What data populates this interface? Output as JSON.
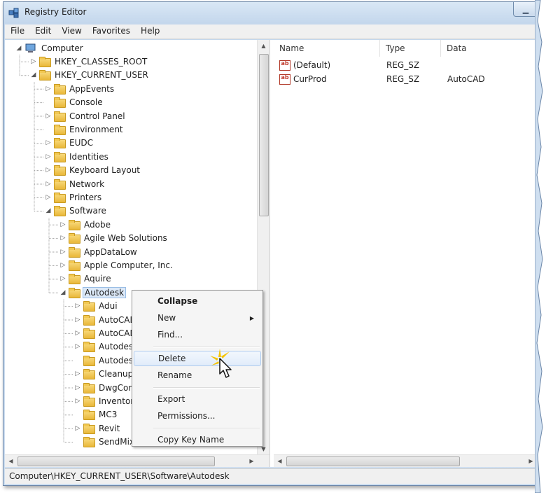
{
  "window": {
    "title": "Registry Editor"
  },
  "menu": [
    "File",
    "Edit",
    "View",
    "Favorites",
    "Help"
  ],
  "tree": [
    {
      "label": "Computer",
      "indent": 0,
      "toggle": "open",
      "icon": "computer-icon"
    },
    {
      "label": "HKEY_CLASSES_ROOT",
      "indent": 1,
      "toggle": "closed"
    },
    {
      "label": "HKEY_CURRENT_USER",
      "indent": 1,
      "toggle": "open"
    },
    {
      "label": "AppEvents",
      "indent": 2,
      "toggle": "closed"
    },
    {
      "label": "Console",
      "indent": 2,
      "toggle": "none"
    },
    {
      "label": "Control Panel",
      "indent": 2,
      "toggle": "closed"
    },
    {
      "label": "Environment",
      "indent": 2,
      "toggle": "none"
    },
    {
      "label": "EUDC",
      "indent": 2,
      "toggle": "closed"
    },
    {
      "label": "Identities",
      "indent": 2,
      "toggle": "closed"
    },
    {
      "label": "Keyboard Layout",
      "indent": 2,
      "toggle": "closed"
    },
    {
      "label": "Network",
      "indent": 2,
      "toggle": "closed"
    },
    {
      "label": "Printers",
      "indent": 2,
      "toggle": "closed"
    },
    {
      "label": "Software",
      "indent": 2,
      "toggle": "open"
    },
    {
      "label": "Adobe",
      "indent": 3,
      "toggle": "closed"
    },
    {
      "label": "Agile Web Solutions",
      "indent": 3,
      "toggle": "closed"
    },
    {
      "label": "AppDataLow",
      "indent": 3,
      "toggle": "closed"
    },
    {
      "label": "Apple Computer, Inc.",
      "indent": 3,
      "toggle": "closed"
    },
    {
      "label": "Aquire",
      "indent": 3,
      "toggle": "closed"
    },
    {
      "label": "Autodesk",
      "indent": 3,
      "toggle": "open",
      "selected": true
    },
    {
      "label": "Adui",
      "indent": 4,
      "toggle": "closed"
    },
    {
      "label": "AutoCAD",
      "indent": 4,
      "toggle": "closed"
    },
    {
      "label": "AutoCAD",
      "indent": 4,
      "toggle": "closed"
    },
    {
      "label": "Autodesk",
      "indent": 4,
      "toggle": "closed"
    },
    {
      "label": "Autodesk",
      "indent": 4,
      "toggle": "none"
    },
    {
      "label": "Cleanup",
      "indent": 4,
      "toggle": "closed"
    },
    {
      "label": "DwgCon",
      "indent": 4,
      "toggle": "closed"
    },
    {
      "label": "Inventor",
      "indent": 4,
      "toggle": "closed"
    },
    {
      "label": "MC3",
      "indent": 4,
      "toggle": "none"
    },
    {
      "label": "Revit",
      "indent": 4,
      "toggle": "closed"
    },
    {
      "label": "SendMix",
      "indent": 4,
      "toggle": "none"
    }
  ],
  "columns": {
    "name": "Name",
    "type": "Type",
    "data": "Data"
  },
  "values": [
    {
      "name": "(Default)",
      "type": "REG_SZ",
      "data": "",
      "icon": "string-value-icon"
    },
    {
      "name": "CurProd",
      "type": "REG_SZ",
      "data": "AutoCAD",
      "icon": "string-value-icon"
    }
  ],
  "context_menu": [
    {
      "label": "Collapse",
      "bold": true
    },
    {
      "label": "New",
      "submenu": true
    },
    {
      "label": "Find..."
    },
    {
      "separator": true
    },
    {
      "label": "Delete",
      "hover": true
    },
    {
      "label": "Rename"
    },
    {
      "separator": true
    },
    {
      "label": "Export"
    },
    {
      "label": "Permissions..."
    },
    {
      "separator": true
    },
    {
      "label": "Copy Key Name"
    }
  ],
  "status": "Computer\\HKEY_CURRENT_USER\\Software\\Autodesk",
  "colors": {
    "selection": "#dce9f8",
    "folder": "#f2c851",
    "titlebar": "#c4d7ec",
    "menu_hover": "#aecbee"
  }
}
